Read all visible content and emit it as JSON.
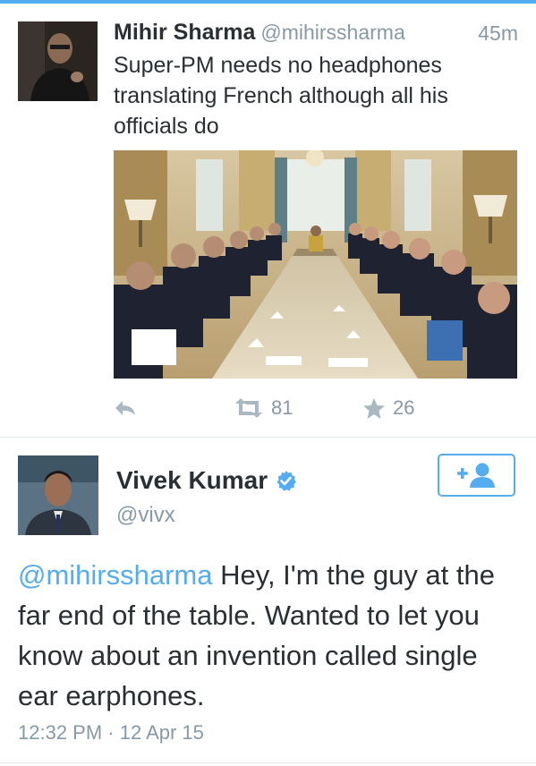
{
  "colors": {
    "accent": "#55acee",
    "muted": "#8899a6",
    "text": "#292f33",
    "icon": "#aab8c2"
  },
  "tweet1": {
    "name": "Mihir Sharma",
    "handle": "@mihirssharma",
    "time": "45m",
    "text": "Super-PM needs no headphones translating French although all his officials do",
    "actions": {
      "reply_icon": "reply-icon",
      "retweet_icon": "retweet-icon",
      "retweets": "81",
      "favorite_icon": "star-icon",
      "favorites": "26"
    }
  },
  "tweet2": {
    "name": "Vivek Kumar",
    "handle": "@vivx",
    "verified_icon": "verified-badge-icon",
    "follow_icon": "follow-user-icon",
    "mention": "@mihirssharma",
    "text": " Hey, I'm the guy at the far end of the table. Wanted to let you know about an invention called single ear earphones.",
    "timestamp": "12:32 PM · 12 Apr 15"
  }
}
